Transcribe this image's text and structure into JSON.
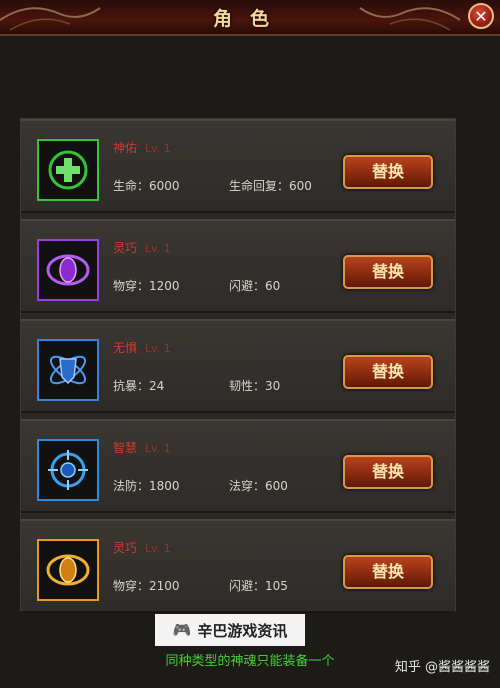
{
  "header": {
    "title": "角色"
  },
  "rows": [
    {
      "name": "神佑",
      "level": "Lv. 1",
      "stat1": "生命：6000",
      "stat2": "生命回复：600",
      "button": "替换",
      "icon": "plus-heal-icon",
      "icon_color": "#37c23a"
    },
    {
      "name": "灵巧",
      "level": "Lv. 1",
      "stat1": "物穿：1200",
      "stat2": "闪避：60",
      "button": "替换",
      "icon": "eye-icon",
      "icon_color": "#9b3de0"
    },
    {
      "name": "无惧",
      "level": "Lv. 1",
      "stat1": "抗暴：24",
      "stat2": "韧性：30",
      "button": "替换",
      "icon": "orbit-shield-icon",
      "icon_color": "#3b7fd8"
    },
    {
      "name": "智慧",
      "level": "Lv. 1",
      "stat1": "法防：1800",
      "stat2": "法穿：600",
      "button": "替换",
      "icon": "crosshair-icon",
      "icon_color": "#2e8ae0"
    },
    {
      "name": "灵巧",
      "level": "Lv. 1",
      "stat1": "物穿：2100",
      "stat2": "闪避：105",
      "button": "替换",
      "icon": "eye-icon",
      "icon_color": "#e89a20"
    }
  ],
  "footer": {
    "note": "同种类型的神魂只能装备一个"
  },
  "watermarks": {
    "site": "辛巴游戏资讯",
    "zhihu": "知乎 @酱酱酱酱"
  }
}
